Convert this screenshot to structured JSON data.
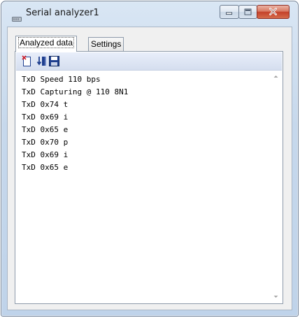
{
  "window": {
    "title": "Serial analyzer1",
    "icons": [
      "app-icon",
      "minimize-icon",
      "maximize-icon",
      "close-icon"
    ]
  },
  "tabs": [
    {
      "label": "Analyzed data",
      "selected": true
    },
    {
      "label": "Settings",
      "selected": false
    }
  ],
  "toolbar": {
    "icons": [
      "clear-icon",
      "capture-icon",
      "save-icon"
    ]
  },
  "log": {
    "lines": [
      "TxD Speed 110 bps",
      "TxD Capturing @ 110 8N1",
      "TxD 0x74 t",
      "TxD 0x69 i",
      "TxD 0x65 e",
      "TxD 0x70 p",
      "TxD 0x69 i",
      "TxD 0x65 e"
    ]
  },
  "colors": {
    "close_button": "#c4412a",
    "toolbar_icon_blue": "#1f3f8f",
    "toolbar_icon_red": "#d0202a"
  }
}
